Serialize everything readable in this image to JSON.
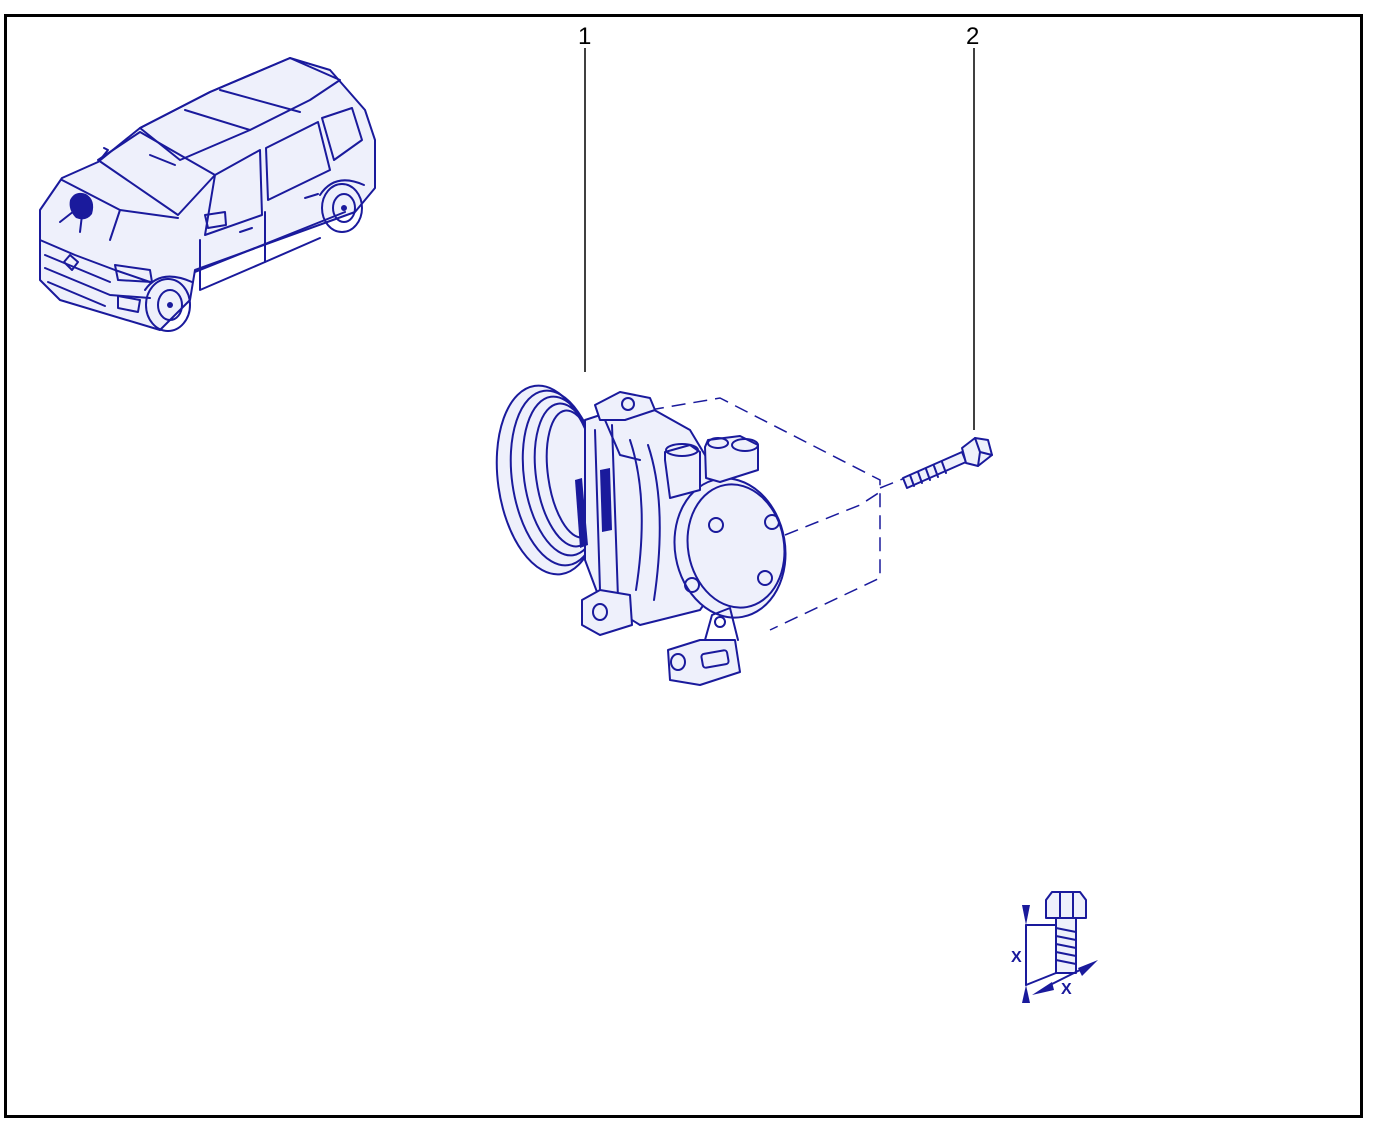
{
  "diagram": {
    "callouts": [
      {
        "id": "1",
        "label": "1"
      },
      {
        "id": "2",
        "label": "2"
      }
    ],
    "torque_symbol": {
      "label_vertical": "X",
      "label_horizontal": "X"
    },
    "colors": {
      "ink": "#1a1a9c",
      "frame": "#000000",
      "background": "#ffffff"
    }
  }
}
